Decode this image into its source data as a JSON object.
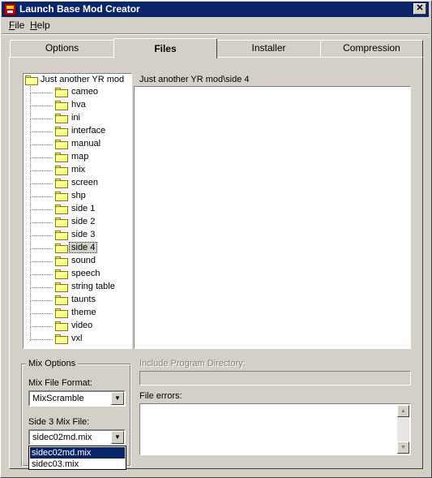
{
  "window": {
    "title": "Launch Base Mod Creator",
    "close_glyph": "✕"
  },
  "menu": {
    "file": {
      "accel": "F",
      "rest": "ile"
    },
    "help": {
      "accel": "H",
      "rest": "elp"
    }
  },
  "tabs": [
    {
      "label": "Options",
      "active": false
    },
    {
      "label": "Files",
      "active": true
    },
    {
      "label": "Installer",
      "active": false
    },
    {
      "label": "Compression",
      "active": false
    }
  ],
  "tree": {
    "root": "Just another YR mod",
    "selected": "side 4",
    "items": [
      "cameo",
      "hva",
      "ini",
      "interface",
      "manual",
      "map",
      "mix",
      "screen",
      "shp",
      "side 1",
      "side 2",
      "side 3",
      "side 4",
      "sound",
      "speech",
      "string table",
      "taunts",
      "theme",
      "video",
      "vxl"
    ]
  },
  "path_label": "Just another YR mod\\side 4",
  "mix_options": {
    "group_title": "Mix Options",
    "format_label": "Mix File Format:",
    "format_value": "MixScramble",
    "side_label": "Side 3 Mix File:",
    "side_value": "sidec02md.mix",
    "dropdown_options": [
      "sidec02md.mix",
      "sidec03.mix"
    ],
    "dropdown_selected": "sidec02md.mix"
  },
  "include_label": "Include Program Directory:",
  "include_value": "",
  "errors_label": "File errors:",
  "glyphs": {
    "dropdown": "▼",
    "scroll_up": "▲",
    "scroll_down": "▼"
  },
  "colors": {
    "titlebar": "#0a246a",
    "face": "#d4d0c8",
    "folder": "#ffff99"
  }
}
